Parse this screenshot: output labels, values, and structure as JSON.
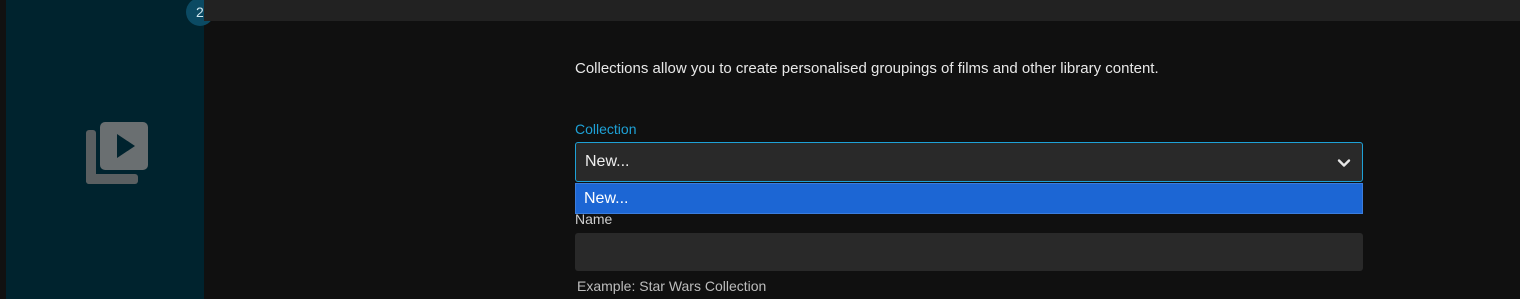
{
  "poster": {
    "badge": "2",
    "icon": "video-library-icon"
  },
  "form": {
    "description": "Collections allow you to create personalised groupings of films and other library content.",
    "collection_label": "Collection",
    "collection_selected": "New...",
    "collection_options": [
      "New..."
    ],
    "name_label": "Name",
    "name_value": "",
    "name_hint": "Example: Star Wars Collection"
  },
  "colors": {
    "accent": "#1ea1d6",
    "dropdown_highlight": "#1c66d4",
    "poster_background": "#00232e"
  }
}
